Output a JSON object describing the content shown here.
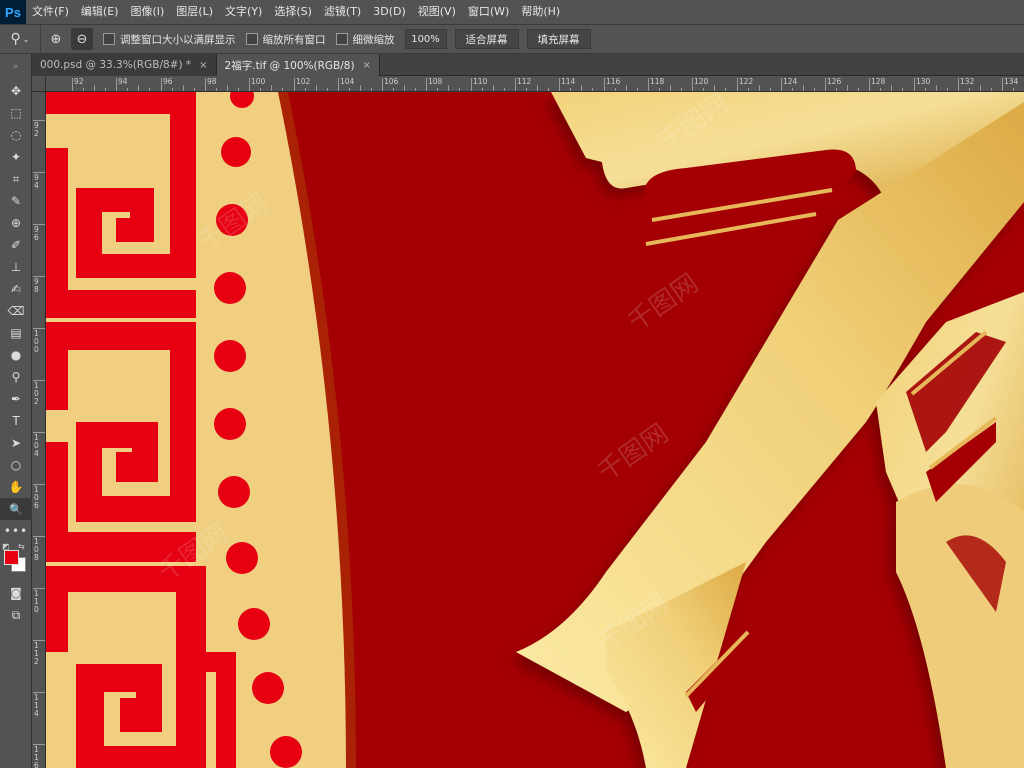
{
  "app": {
    "logo": "Ps"
  },
  "menu": [
    "文件(F)",
    "编辑(E)",
    "图像(I)",
    "图层(L)",
    "文字(Y)",
    "选择(S)",
    "滤镜(T)",
    "3D(D)",
    "视图(V)",
    "窗口(W)",
    "帮助(H)"
  ],
  "options": {
    "tool_icon": "zoom-icon",
    "resize_windows_label": "调整窗口大小以满屏显示",
    "zoom_all_label": "缩放所有窗口",
    "scrubby_zoom_label": "细微缩放",
    "zoom_value": "100%",
    "fit_screen_label": "适合屏幕",
    "fill_screen_label": "填充屏幕"
  },
  "tabs": [
    {
      "label": "000.psd @ 33.3%(RGB/8#) *",
      "active": false
    },
    {
      "label": "2福字.tif @ 100%(RGB/8)",
      "active": true
    }
  ],
  "tabs_close": "×",
  "ruler_top_ticks": [
    "92",
    "94",
    "96",
    "98",
    "100",
    "102",
    "104",
    "106",
    "108",
    "110",
    "112",
    "114",
    "116",
    "118",
    "120",
    "122",
    "124",
    "126",
    "128",
    "130",
    "132",
    "134"
  ],
  "ruler_left_ticks": [
    "92",
    "94",
    "96",
    "98",
    "100",
    "102",
    "104",
    "106",
    "108",
    "110",
    "112",
    "114",
    "116"
  ],
  "tools": [
    "move-icon",
    "marquee-icon",
    "lasso-icon",
    "magic-wand-icon",
    "crop-icon",
    "eyedropper-icon",
    "healing-icon",
    "brush-icon",
    "stamp-icon",
    "history-brush-icon",
    "eraser-icon",
    "gradient-icon",
    "blur-icon",
    "dodge-icon",
    "pen-icon",
    "type-icon",
    "path-select-icon",
    "shape-icon",
    "hand-icon",
    "zoom-icon"
  ],
  "tool_glyphs": [
    "✥",
    "⬚",
    "◌",
    "✦",
    "⌗",
    "✎",
    "⊕",
    "✐",
    "⊥",
    "✍",
    "⌫",
    "▤",
    "●",
    "⚲",
    "✒",
    "T",
    "➤",
    "○",
    "✋",
    "🔍"
  ],
  "colors": {
    "foreground": "#e60012",
    "background": "#ffffff",
    "canvas_red": "#a40003",
    "gold": "#e8c15a"
  },
  "watermark": "千图网"
}
